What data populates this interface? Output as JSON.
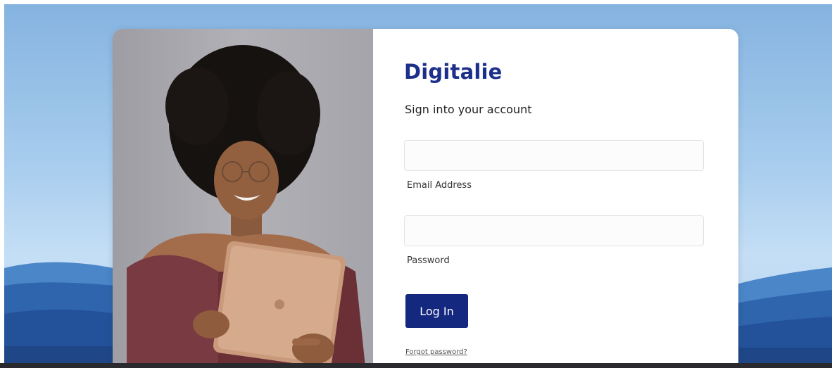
{
  "brand": {
    "name": "Digitalie",
    "color": "#1c2f8a"
  },
  "form": {
    "subtitle": "Sign into your account",
    "email": {
      "label": "Email Address",
      "value": "",
      "placeholder": ""
    },
    "password": {
      "label": "Password",
      "value": "",
      "placeholder": ""
    },
    "login_button": {
      "label": "Log In",
      "color": "#14287f"
    },
    "forgot_link": "Forgot password?"
  },
  "photo": {
    "icon": "woman-with-tablet-photo"
  },
  "colors": {
    "background_sky": "#a8cdee",
    "hills": "#3f78c0"
  }
}
